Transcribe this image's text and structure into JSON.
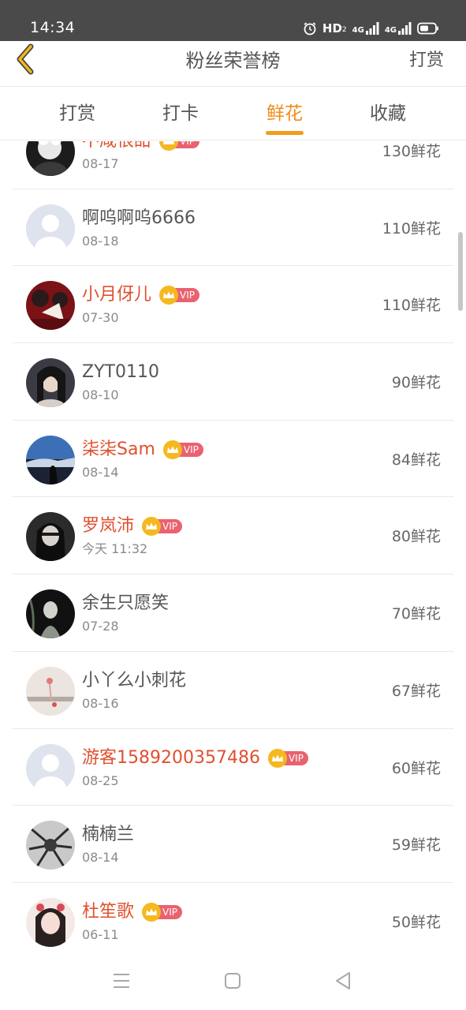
{
  "status_bar": {
    "time": "14:34",
    "hd_label": "HD",
    "hd_sub": "2",
    "network_1": "4G",
    "network_2": "4G",
    "icons": [
      "alarm-icon",
      "signal-icon",
      "signal-icon",
      "battery-icon"
    ]
  },
  "header": {
    "title": "粉丝荣誉榜",
    "right_action": "打赏",
    "back_icon": "chevron-left-icon",
    "accent_color": "#f2b81c"
  },
  "tabs": [
    {
      "label": "打赏",
      "active": false
    },
    {
      "label": "打卡",
      "active": false
    },
    {
      "label": "鲜花",
      "active": true
    },
    {
      "label": "收藏",
      "active": false
    }
  ],
  "colors": {
    "active_tab": "#f08c18",
    "vip_name": "#e0502f",
    "normal_name": "#555555",
    "vip_badge": "#e9626f",
    "crown": "#f5b820"
  },
  "fans": [
    {
      "name": "不咸很甜",
      "vip": true,
      "vip_label": "VIP",
      "date": "08-17",
      "amount": "130鲜花",
      "avatar_icon": "avatar-photo"
    },
    {
      "name": "啊呜啊呜6666",
      "vip": false,
      "vip_label": "",
      "date": "08-18",
      "amount": "110鲜花",
      "avatar_icon": "default-avatar-icon"
    },
    {
      "name": "小月伢儿",
      "vip": true,
      "vip_label": "VIP",
      "date": "07-30",
      "amount": "110鲜花",
      "avatar_icon": "avatar-photo"
    },
    {
      "name": "ZYT0110",
      "vip": false,
      "vip_label": "",
      "date": "08-10",
      "amount": "90鲜花",
      "avatar_icon": "avatar-photo"
    },
    {
      "name": "柒柒Sam",
      "vip": true,
      "vip_label": "VIP",
      "date": "08-14",
      "amount": "84鲜花",
      "avatar_icon": "avatar-photo"
    },
    {
      "name": "罗岚沛",
      "vip": true,
      "vip_label": "VIP",
      "date": "今天 11:32",
      "amount": "80鲜花",
      "avatar_icon": "avatar-photo"
    },
    {
      "name": "余生只愿笑",
      "vip": false,
      "vip_label": "",
      "date": "07-28",
      "amount": "70鲜花",
      "avatar_icon": "avatar-photo"
    },
    {
      "name": "小丫么小刺花",
      "vip": false,
      "vip_label": "",
      "date": "08-16",
      "amount": "67鲜花",
      "avatar_icon": "avatar-photo"
    },
    {
      "name": "游客1589200357486",
      "vip": true,
      "vip_label": "VIP",
      "date": "08-25",
      "amount": "60鲜花",
      "avatar_icon": "default-avatar-icon"
    },
    {
      "name": "楠楠兰",
      "vip": false,
      "vip_label": "",
      "date": "08-14",
      "amount": "59鲜花",
      "avatar_icon": "avatar-photo"
    },
    {
      "name": "杜笙歌",
      "vip": true,
      "vip_label": "VIP",
      "date": "06-11",
      "amount": "50鲜花",
      "avatar_icon": "avatar-photo"
    }
  ],
  "system_nav": {
    "icons": [
      "menu-icon",
      "home-square-icon",
      "back-triangle-icon"
    ]
  }
}
